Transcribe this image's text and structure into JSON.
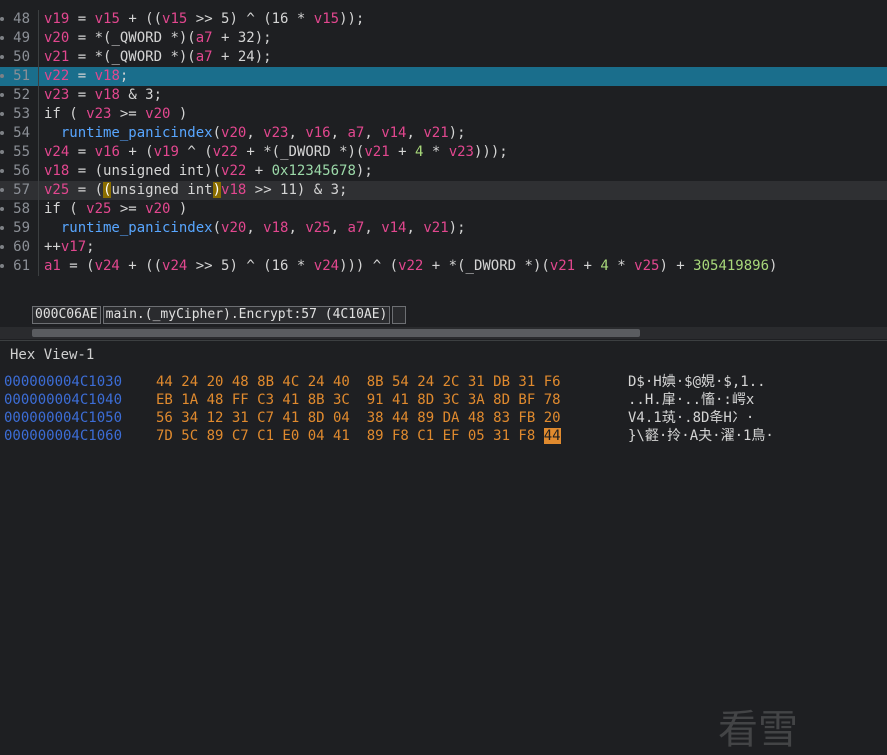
{
  "code_lines": [
    {
      "num": "48",
      "segments": [
        [
          "v",
          "v19"
        ],
        [
          "op",
          " = "
        ],
        [
          "v",
          "v15"
        ],
        [
          "op",
          " + (("
        ],
        [
          "v",
          "v15"
        ],
        [
          "op",
          " >> 5) ^ (16 * "
        ],
        [
          "v",
          "v15"
        ],
        [
          "op",
          "));"
        ]
      ]
    },
    {
      "num": "49",
      "segments": [
        [
          "v",
          "v20"
        ],
        [
          "op",
          " = *(_QWORD *)("
        ],
        [
          "v",
          "a7"
        ],
        [
          "op",
          " + 32);"
        ]
      ]
    },
    {
      "num": "50",
      "segments": [
        [
          "v",
          "v21"
        ],
        [
          "op",
          " = *(_QWORD *)("
        ],
        [
          "v",
          "a7"
        ],
        [
          "op",
          " + 24);"
        ]
      ]
    },
    {
      "num": "51",
      "segments": [
        [
          "v",
          "v22"
        ],
        [
          "op",
          " = "
        ],
        [
          "v",
          "v18"
        ],
        [
          "op",
          ";"
        ]
      ],
      "highlight": true
    },
    {
      "num": "52",
      "segments": [
        [
          "v",
          "v23"
        ],
        [
          "op",
          " = "
        ],
        [
          "v",
          "v18"
        ],
        [
          "op",
          " & 3;"
        ]
      ]
    },
    {
      "num": "53",
      "segments": [
        [
          "op",
          "if ( "
        ],
        [
          "v",
          "v23"
        ],
        [
          "op",
          " >= "
        ],
        [
          "v",
          "v20"
        ],
        [
          "op",
          " )"
        ]
      ]
    },
    {
      "num": "54",
      "segments": [
        [
          "op",
          "  "
        ],
        [
          "fn",
          "runtime_panicindex"
        ],
        [
          "op",
          "("
        ],
        [
          "v",
          "v20"
        ],
        [
          "op",
          ", "
        ],
        [
          "v",
          "v23"
        ],
        [
          "op",
          ", "
        ],
        [
          "v",
          "v16"
        ],
        [
          "op",
          ", "
        ],
        [
          "v",
          "a7"
        ],
        [
          "op",
          ", "
        ],
        [
          "v",
          "v14"
        ],
        [
          "op",
          ", "
        ],
        [
          "v",
          "v21"
        ],
        [
          "op",
          ");"
        ]
      ]
    },
    {
      "num": "55",
      "segments": [
        [
          "v",
          "v24"
        ],
        [
          "op",
          " = "
        ],
        [
          "v",
          "v16"
        ],
        [
          "op",
          " + ("
        ],
        [
          "v",
          "v19"
        ],
        [
          "op",
          " ^ ("
        ],
        [
          "v",
          "v22"
        ],
        [
          "op",
          " + *(_DWORD *)("
        ],
        [
          "v",
          "v21"
        ],
        [
          "op",
          " + "
        ],
        [
          "num2",
          "4"
        ],
        [
          "op",
          " * "
        ],
        [
          "v",
          "v23"
        ],
        [
          "op",
          ")));"
        ]
      ]
    },
    {
      "num": "56",
      "segments": [
        [
          "v",
          "v18"
        ],
        [
          "op",
          " = (unsigned int)("
        ],
        [
          "v",
          "v22"
        ],
        [
          "op",
          " + "
        ],
        [
          "hex",
          "0x12345678"
        ],
        [
          "op",
          ");"
        ]
      ]
    },
    {
      "num": "57",
      "segments": [
        [
          "v",
          "v25"
        ],
        [
          "op",
          " = ("
        ],
        [
          "paren",
          "("
        ],
        [
          "op",
          "unsigned int"
        ],
        [
          "paren",
          ")"
        ],
        [
          "v",
          "v18"
        ],
        [
          "op",
          " >> 11) & 3;"
        ]
      ],
      "current": true
    },
    {
      "num": "58",
      "segments": [
        [
          "op",
          "if ( "
        ],
        [
          "v",
          "v25"
        ],
        [
          "op",
          " >= "
        ],
        [
          "v",
          "v20"
        ],
        [
          "op",
          " )"
        ]
      ]
    },
    {
      "num": "59",
      "segments": [
        [
          "op",
          "  "
        ],
        [
          "fn",
          "runtime_panicindex"
        ],
        [
          "op",
          "("
        ],
        [
          "v",
          "v20"
        ],
        [
          "op",
          ", "
        ],
        [
          "v",
          "v18"
        ],
        [
          "op",
          ", "
        ],
        [
          "v",
          "v25"
        ],
        [
          "op",
          ", "
        ],
        [
          "v",
          "a7"
        ],
        [
          "op",
          ", "
        ],
        [
          "v",
          "v14"
        ],
        [
          "op",
          ", "
        ],
        [
          "v",
          "v21"
        ],
        [
          "op",
          ");"
        ]
      ]
    },
    {
      "num": "60",
      "segments": [
        [
          "op",
          "++"
        ],
        [
          "v",
          "v17"
        ],
        [
          "op",
          ";"
        ]
      ]
    },
    {
      "num": "61",
      "segments": [
        [
          "v",
          "a1"
        ],
        [
          "op",
          " = ("
        ],
        [
          "v",
          "v24"
        ],
        [
          "op",
          " + (("
        ],
        [
          "v",
          "v24"
        ],
        [
          "op",
          " >> 5) ^ (16 * "
        ],
        [
          "v",
          "v24"
        ],
        [
          "op",
          "))) ^ ("
        ],
        [
          "v",
          "v22"
        ],
        [
          "op",
          " + *(_DWORD *)("
        ],
        [
          "v",
          "v21"
        ],
        [
          "op",
          " + "
        ],
        [
          "num2",
          "4"
        ],
        [
          "op",
          " * "
        ],
        [
          "v",
          "v25"
        ],
        [
          "op",
          ") + "
        ],
        [
          "num2",
          "305419896"
        ],
        [
          "op",
          ")"
        ]
      ]
    }
  ],
  "status": {
    "address": "000C06AE",
    "location": "main.(_myCipher).Encrypt:57 (4C10AE)"
  },
  "hex_view": {
    "title": "Hex View-1",
    "rows": [
      {
        "addr": "000000004C1030",
        "bytes": "44 24 20 48 8B 4C 24 40  8B 54 24 2C 31 DB 31 F6",
        "ascii": "D$·H婰·$@娊·$,1.."
      },
      {
        "addr": "000000004C1040",
        "bytes": "EB 1A 48 FF C3 41 8B 3C  91 41 8D 3C 3A 8D BF 78",
        "ascii": "..H.肁·..慉·:崿x"
      },
      {
        "addr": "000000004C1050",
        "bytes": "56 34 12 31 C7 41 8D 04  38 44 89 DA 48 83 FB 20",
        "ascii": "V4.1茿·.8D夅H冫·"
      },
      {
        "addr": "000000004C1060",
        "bytes": "7D 5C 89 C7 C1 E0 04 41  89 F8 C1 EF 05 31 F8 ",
        "bytes_sel": "44",
        "ascii": "}\\壡·拎·A夬·濯·1鳥·"
      }
    ]
  },
  "watermark": "看雪"
}
